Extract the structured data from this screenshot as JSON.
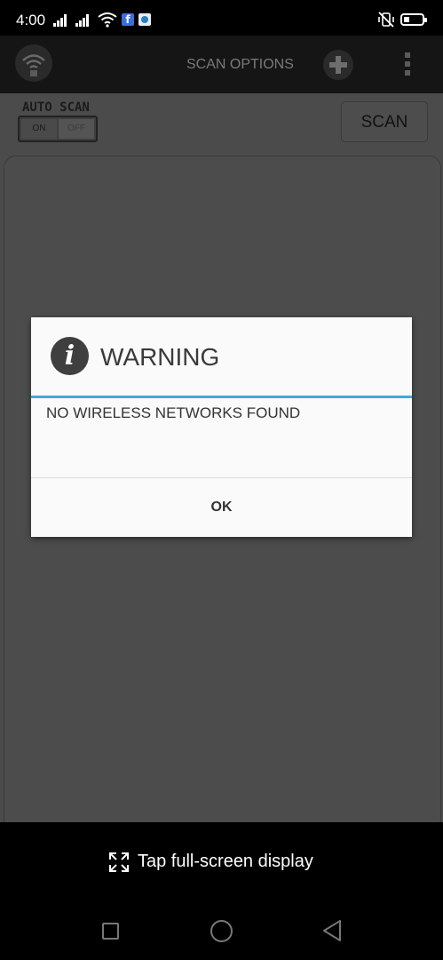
{
  "status_bar": {
    "time": "4:00",
    "icons": [
      "signal-icon",
      "signal-icon",
      "wifi-icon",
      "facebook-icon",
      "app-icon",
      "vibrate-mute-icon",
      "battery-icon"
    ]
  },
  "app_bar": {
    "title": "SCAN OPTIONS",
    "logo_icon": "wifi-scanner-logo-icon",
    "add_icon": "plus-icon",
    "menu_icon": "overflow-menu-icon"
  },
  "controls": {
    "auto_scan_label": "AUTO SCAN",
    "toggle_on": "ON",
    "toggle_off": "OFF",
    "scan_button": "SCAN"
  },
  "dialog": {
    "icon": "info-icon",
    "title": "WARNING",
    "message": "NO WIRELESS NETWORKS FOUND",
    "ok_label": "OK",
    "accent_color": "#45a8d8"
  },
  "banner": {
    "icon": "fullscreen-expand-icon",
    "text": "Tap full-screen display"
  },
  "nav_bar": {
    "icons": [
      "recents-square-icon",
      "home-circle-icon",
      "back-triangle-icon"
    ]
  }
}
